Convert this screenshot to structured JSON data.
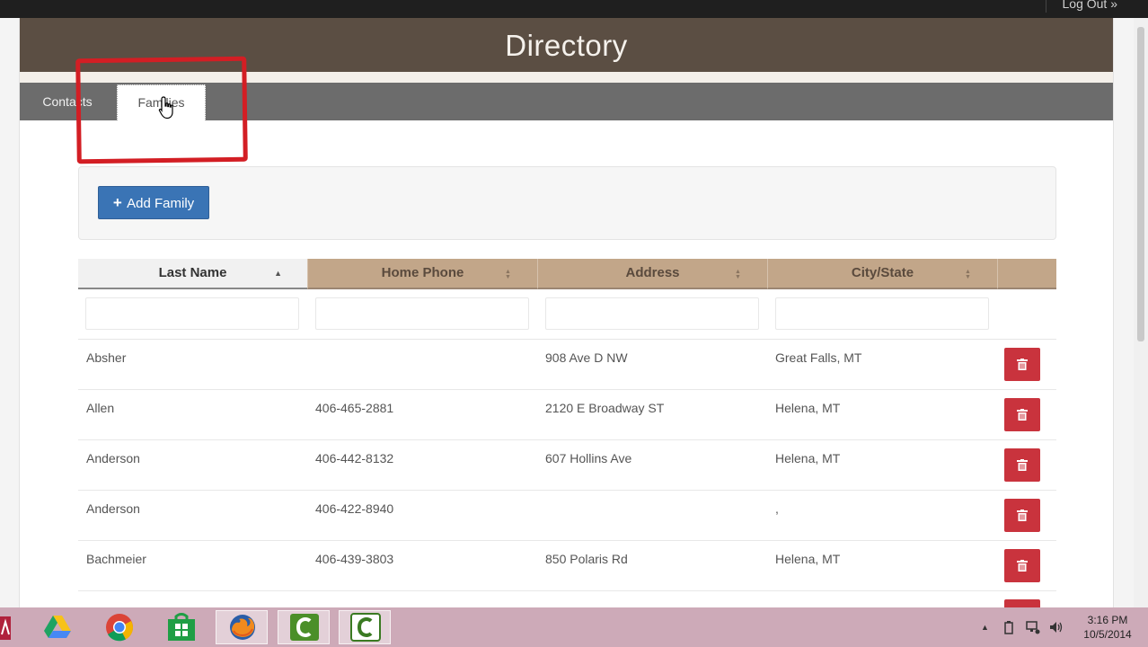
{
  "topbar": {
    "logout_label": "Log Out »"
  },
  "header": {
    "title": "Directory"
  },
  "tabs": [
    {
      "label": "Contacts",
      "active": false
    },
    {
      "label": "Families",
      "active": true
    }
  ],
  "toolbar": {
    "add_plus": "+",
    "add_label": "Add Family"
  },
  "table": {
    "columns": [
      "Last Name",
      "Home Phone",
      "Address",
      "City/State"
    ],
    "sort_asc_glyph": "▲",
    "sort_both_glyph": "▲▼",
    "rows": [
      {
        "last": "Absher",
        "phone": "",
        "address": "908 Ave D NW",
        "city": "Great Falls, MT"
      },
      {
        "last": "Allen",
        "phone": "406-465-2881",
        "address": "2120 E Broadway ST",
        "city": "Helena, MT"
      },
      {
        "last": "Anderson",
        "phone": "406-442-8132",
        "address": "607 Hollins Ave",
        "city": "Helena, MT"
      },
      {
        "last": "Anderson",
        "phone": "406-422-8940",
        "address": "",
        "city": ","
      },
      {
        "last": "Bachmeier",
        "phone": "406-439-3803",
        "address": "850 Polaris Rd",
        "city": "Helena, MT"
      }
    ]
  },
  "colors": {
    "header_bg": "#5b4e43",
    "tabbar_bg": "#6c6c6c",
    "column_header_bg": "#c2a689",
    "primary_button": "#3a74b5",
    "delete_button": "#c9333d",
    "callout_red": "#d31e24",
    "taskbar_bg": "#cdaab8"
  },
  "taskbar": {
    "icons": [
      "app-red-icon",
      "google-drive-icon",
      "chrome-icon",
      "store-icon",
      "firefox-icon",
      "camtasia-icon",
      "camtasia-recorder-icon"
    ],
    "clock_time": "3:16 PM",
    "clock_date": "10/5/2014"
  }
}
